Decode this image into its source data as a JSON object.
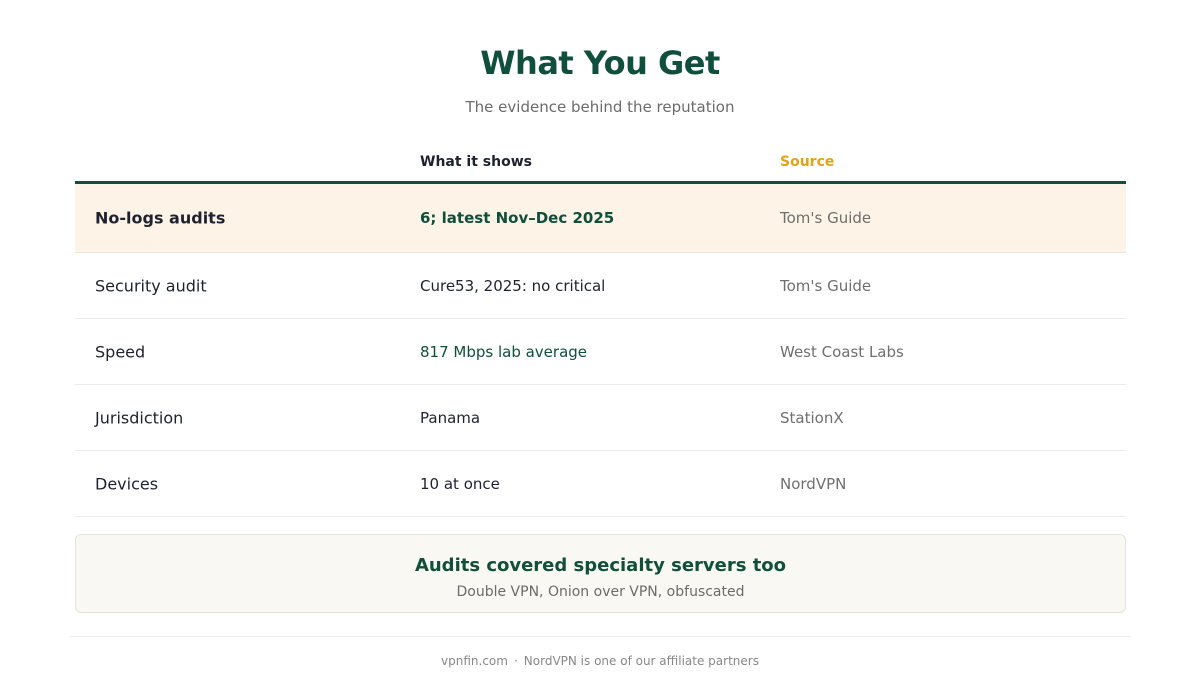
{
  "header": {
    "title": "What You Get",
    "subtitle": "The evidence behind the reputation"
  },
  "table": {
    "columns": {
      "label": "",
      "what": "What it shows",
      "source": "Source"
    },
    "rows": [
      {
        "label": "No-logs audits",
        "value": "6; latest Nov–Dec 2025",
        "source": "Tom's Guide",
        "highlighted": true
      },
      {
        "label": "Security audit",
        "value": "Cure53, 2025: no critical",
        "source": "Tom's Guide"
      },
      {
        "label": "Speed",
        "value": "817 Mbps lab average",
        "source": "West Coast Labs"
      },
      {
        "label": "Jurisdiction",
        "value": "Panama",
        "source": "StationX"
      },
      {
        "label": "Devices",
        "value": "10 at once",
        "source": "NordVPN"
      }
    ]
  },
  "note": {
    "title": "Audits covered specialty servers too",
    "subtitle": "Double VPN, Onion over VPN, obfuscated"
  },
  "footer": {
    "site": "vpnfin.com",
    "separator": "·",
    "disclosure": "NordVPN is one of our affiliate partners"
  },
  "colors": {
    "accent_green": "#0f4f3b",
    "accent_gold": "#e3a21a",
    "highlight_bg": "#fdf3e6"
  }
}
